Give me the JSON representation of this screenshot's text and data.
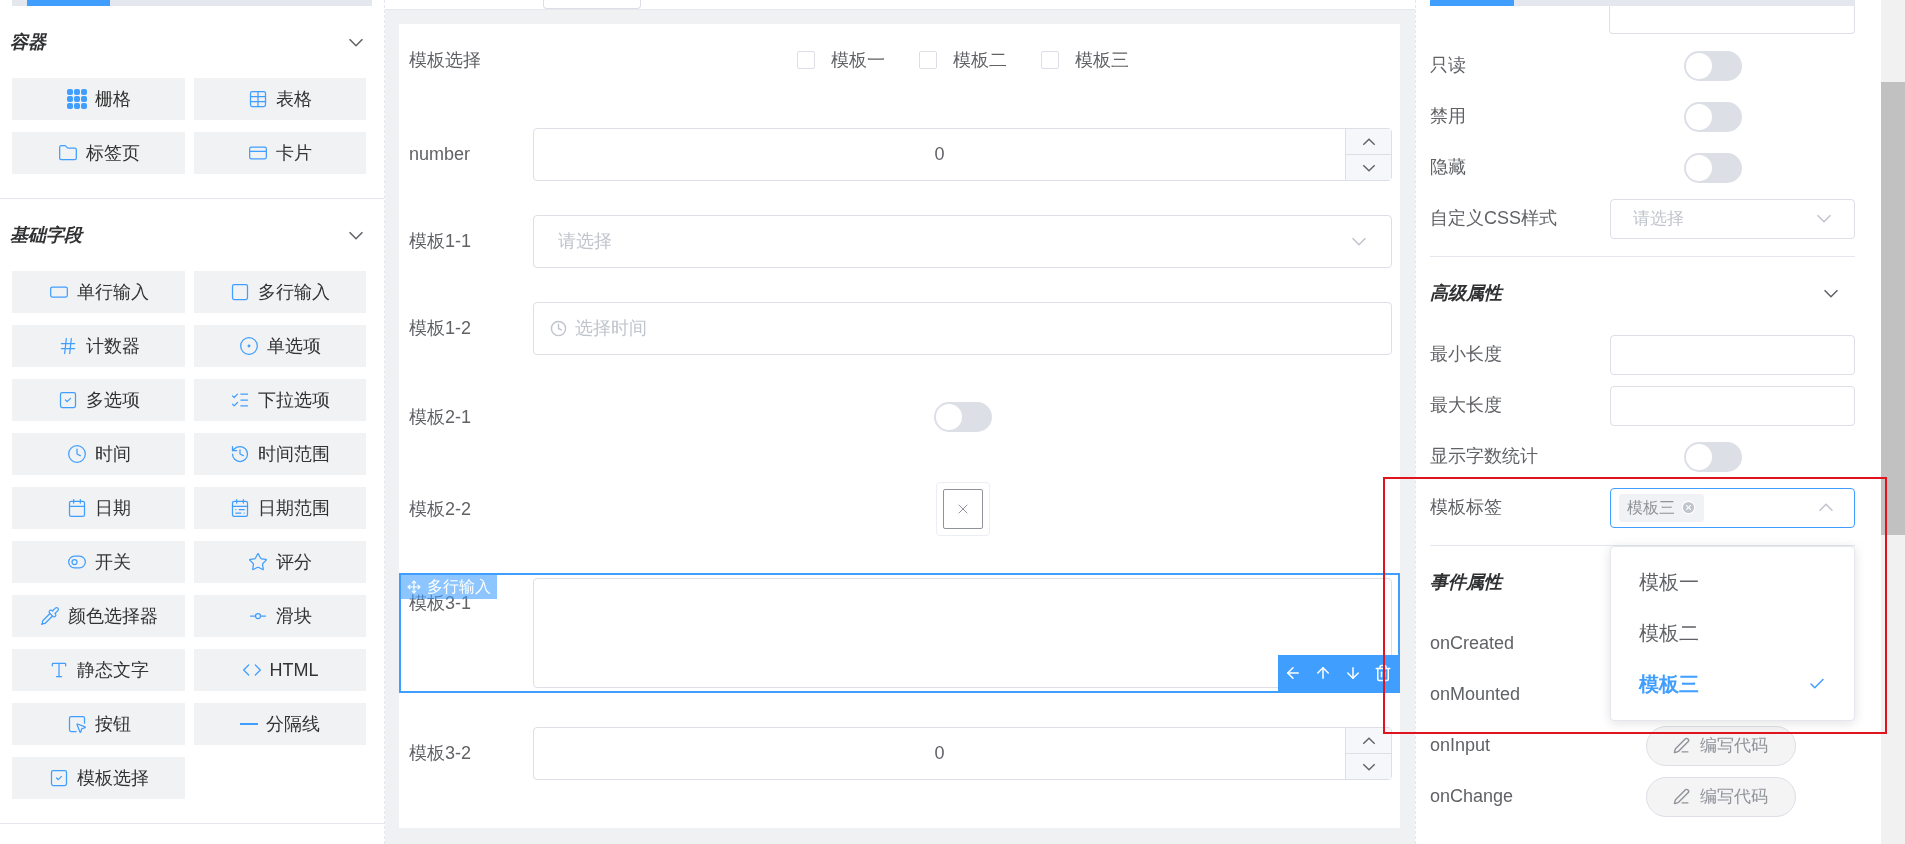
{
  "palette": {
    "sections": [
      {
        "title": "容器",
        "expanded": true,
        "items": [
          {
            "label": "栅格",
            "kind": "grid"
          },
          {
            "label": "表格",
            "kind": "table"
          },
          {
            "label": "标签页",
            "kind": "tabs"
          },
          {
            "label": "卡片",
            "kind": "card"
          }
        ]
      },
      {
        "title": "基础字段",
        "expanded": true,
        "items": [
          {
            "label": "单行输入",
            "kind": "input"
          },
          {
            "label": "多行输入",
            "kind": "textarea"
          },
          {
            "label": "计数器",
            "kind": "number"
          },
          {
            "label": "单选项",
            "kind": "radio"
          },
          {
            "label": "多选项",
            "kind": "checkbox"
          },
          {
            "label": "下拉选项",
            "kind": "select"
          },
          {
            "label": "时间",
            "kind": "time"
          },
          {
            "label": "时间范围",
            "kind": "time-range"
          },
          {
            "label": "日期",
            "kind": "date"
          },
          {
            "label": "日期范围",
            "kind": "date-range"
          },
          {
            "label": "开关",
            "kind": "switch"
          },
          {
            "label": "评分",
            "kind": "rate"
          },
          {
            "label": "颜色选择器",
            "kind": "color"
          },
          {
            "label": "滑块",
            "kind": "slider"
          },
          {
            "label": "静态文字",
            "kind": "static-text"
          },
          {
            "label": "HTML",
            "kind": "html"
          },
          {
            "label": "按钮",
            "kind": "button"
          },
          {
            "label": "分隔线",
            "kind": "divider"
          },
          {
            "label": "模板选择",
            "kind": "template"
          }
        ]
      }
    ]
  },
  "form": {
    "fields": [
      {
        "kind": "checkbox_group",
        "label": "模板选择",
        "selected": false,
        "options": [
          {
            "label": "模板一",
            "checked": false
          },
          {
            "label": "模板二",
            "checked": false
          },
          {
            "label": "模板三",
            "checked": false
          }
        ]
      },
      {
        "kind": "number",
        "label": "number",
        "value": "0",
        "selected": false
      },
      {
        "kind": "select",
        "label": "模板1-1",
        "placeholder": "请选择",
        "selected": false
      },
      {
        "kind": "time",
        "label": "模板1-2",
        "placeholder": "选择时间",
        "selected": false
      },
      {
        "kind": "switch",
        "label": "模板2-1",
        "on": false,
        "selected": false
      },
      {
        "kind": "upload",
        "label": "模板2-2",
        "selected": false
      },
      {
        "kind": "textarea",
        "label": "模板3-1",
        "selected": true,
        "widget_name": "多行输入"
      },
      {
        "kind": "number",
        "label": "模板3-2",
        "value": "0",
        "selected": false
      }
    ]
  },
  "properties": {
    "rows": [
      {
        "kind": "switch",
        "label": "只读",
        "on": false
      },
      {
        "kind": "switch",
        "label": "禁用",
        "on": false
      },
      {
        "kind": "switch",
        "label": "隐藏",
        "on": false
      },
      {
        "kind": "select",
        "label": "自定义CSS样式",
        "placeholder": "请选择"
      }
    ],
    "sections": [
      {
        "title": "高级属性",
        "expanded": true,
        "rows": [
          {
            "kind": "input",
            "label": "最小长度"
          },
          {
            "kind": "input",
            "label": "最大长度"
          },
          {
            "kind": "switch",
            "label": "显示字数统计",
            "on": false
          },
          {
            "kind": "tags",
            "label": "模板标签",
            "tags": [
              {
                "label": "模板三"
              }
            ],
            "open": true,
            "options": [
              {
                "label": "模板一",
                "selected": false
              },
              {
                "label": "模板二",
                "selected": false
              },
              {
                "label": "模板三",
                "selected": true
              }
            ]
          }
        ]
      },
      {
        "title": "事件属性",
        "rows": [
          {
            "kind": "event",
            "label": "onCreated"
          },
          {
            "kind": "event",
            "label": "onMounted"
          },
          {
            "kind": "event",
            "label": "onInput",
            "button": "编写代码"
          },
          {
            "kind": "event",
            "label": "onChange",
            "button": "编写代码"
          }
        ]
      }
    ]
  }
}
